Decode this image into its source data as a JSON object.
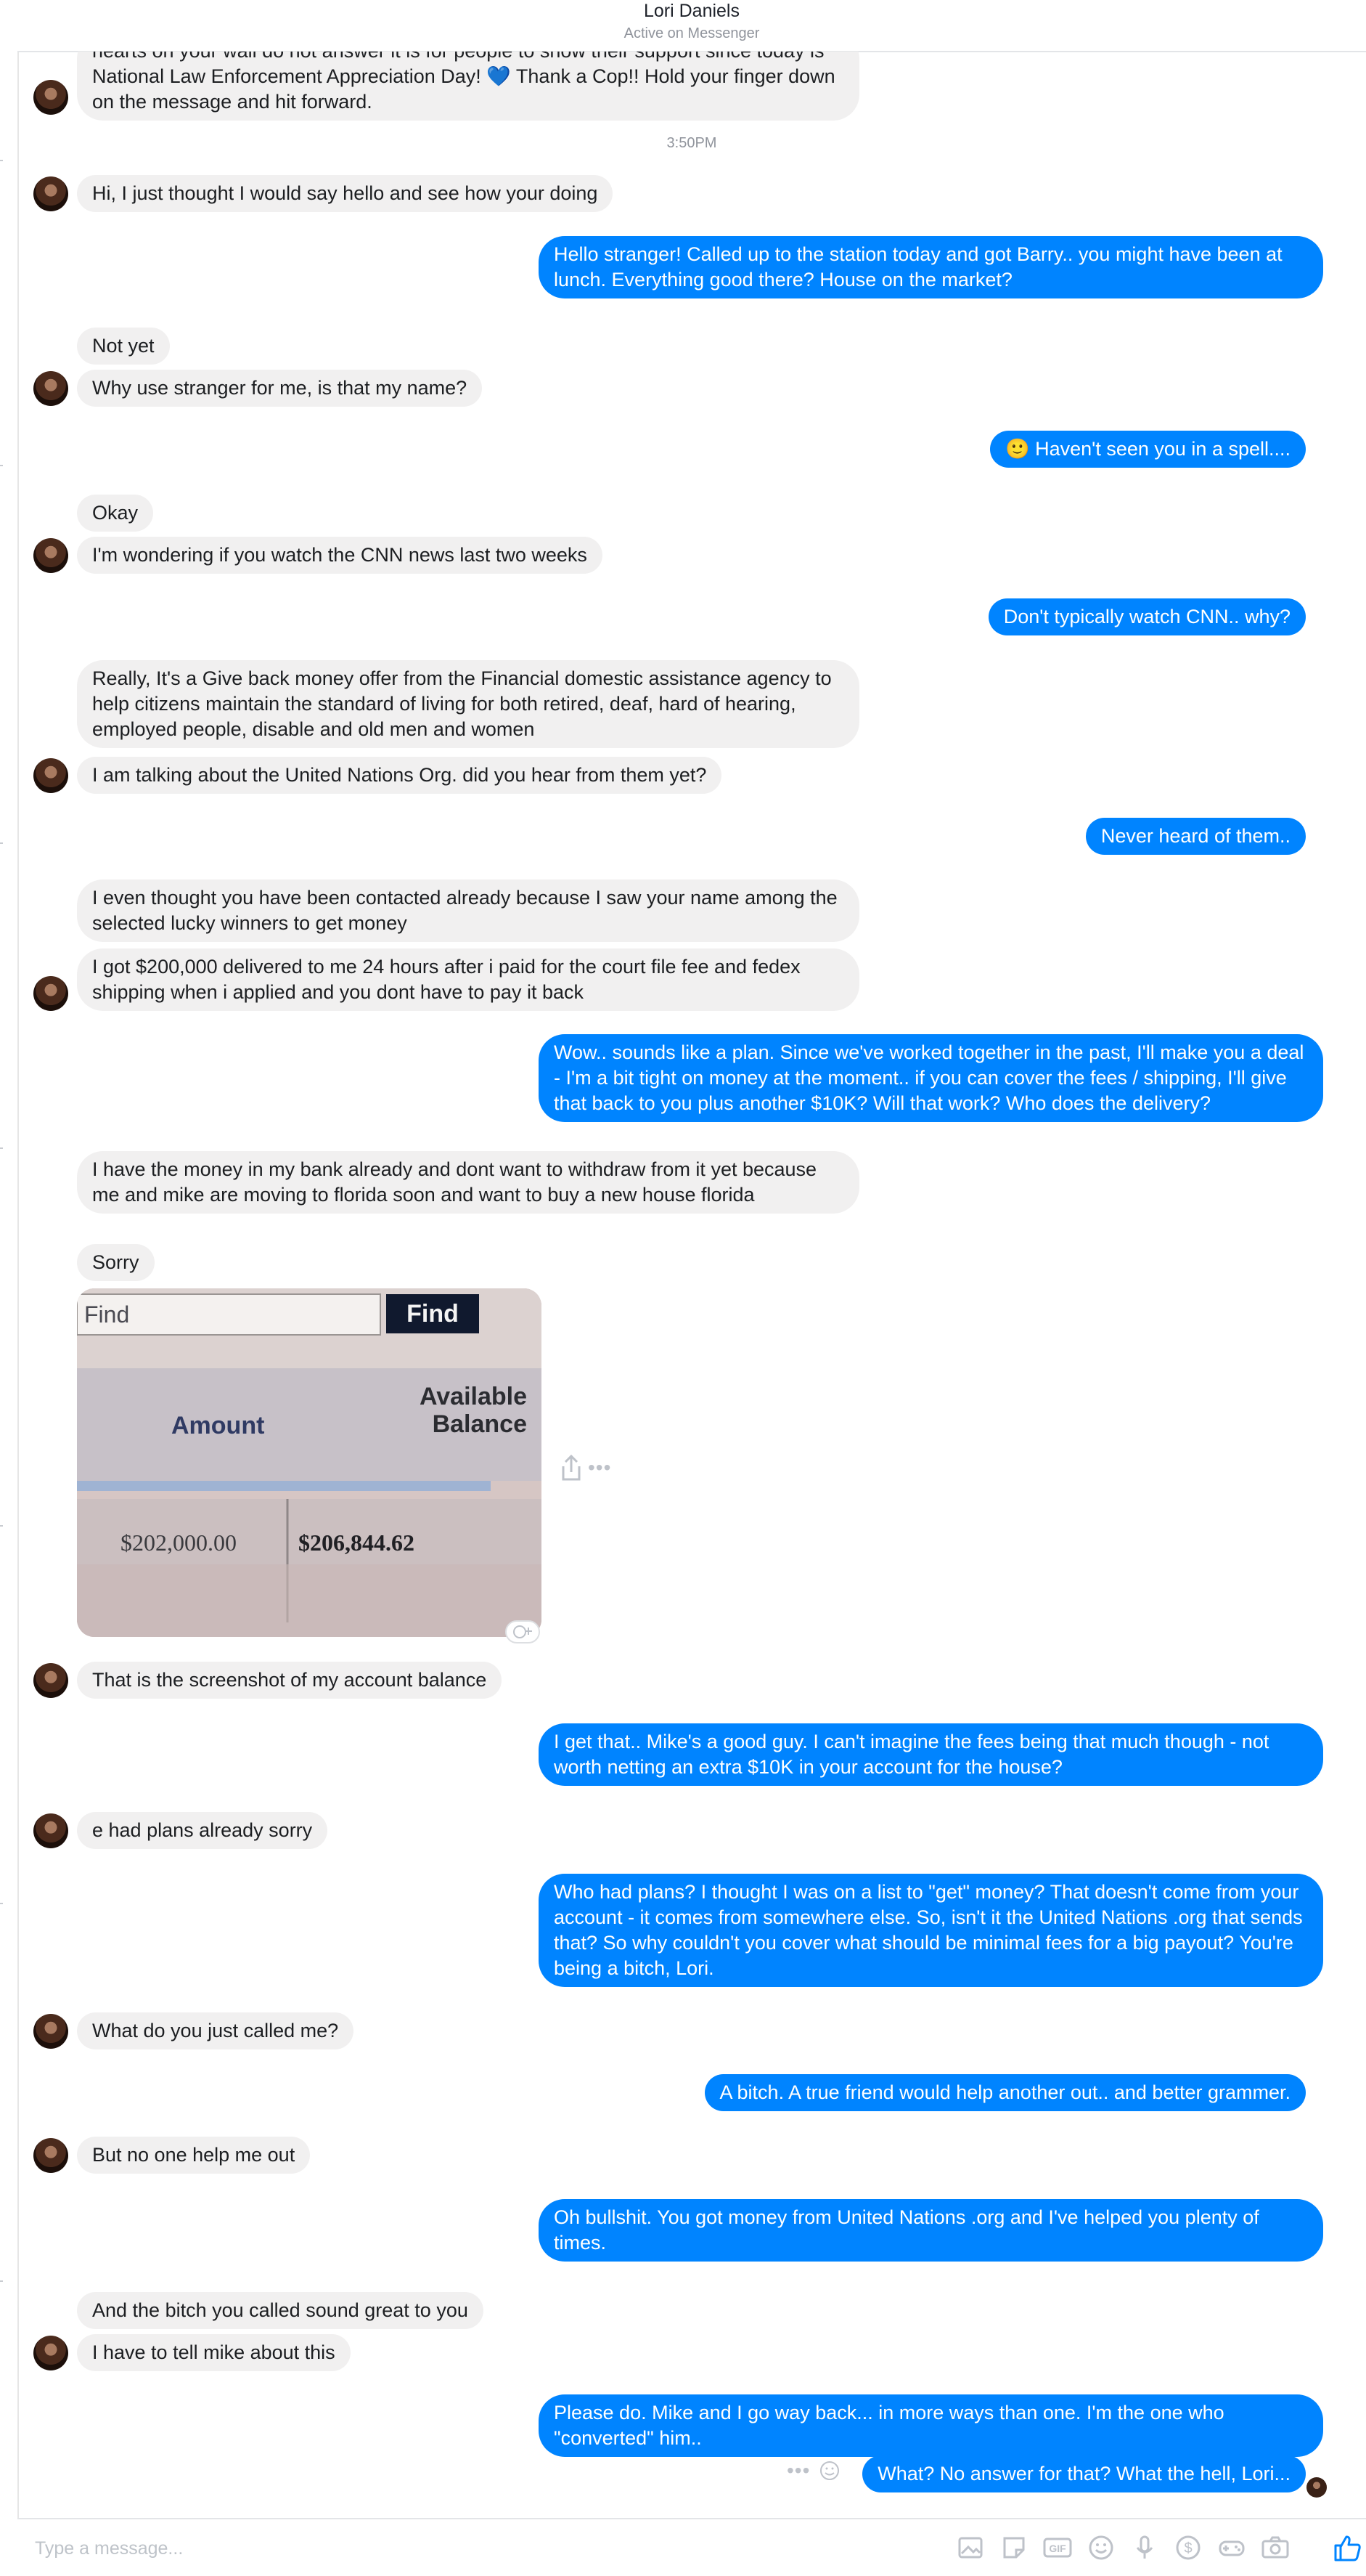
{
  "header": {
    "name": "Lori Daniels",
    "status": "Active on Messenger"
  },
  "colors": {
    "accent": "#0084ff",
    "incoming": "#f1f0f0"
  },
  "thread": {
    "partial_message": "hearts on your wall do not answer it is for people to show their support since today is National Law Enforcement Appreciation Day! 💙 Thank a Cop!! Hold your finger down on the message and hit forward.",
    "timestamp": "3:50PM",
    "messages": [
      {
        "from": "them",
        "text": "Hi, I just thought I would say hello and see how your doing"
      },
      {
        "from": "me",
        "text": "Hello stranger! Called up to the station today and got Barry.. you might have been at lunch. Everything good there? House on the market?"
      },
      {
        "from": "them",
        "text": "Not yet"
      },
      {
        "from": "them",
        "text": "Why use stranger for me, is that my name?"
      },
      {
        "from": "me",
        "text": "🙂 Haven't seen you in a spell...."
      },
      {
        "from": "them",
        "text": "Okay"
      },
      {
        "from": "them",
        "text": "I'm wondering if you watch the CNN news last two weeks"
      },
      {
        "from": "me",
        "text": "Don't typically watch CNN.. why?"
      },
      {
        "from": "them",
        "text": "Really, It's a Give back money offer from the Financial domestic assistance agency to help citizens maintain the standard of living for both retired, deaf, hard of hearing, employed people, disable and old men and women"
      },
      {
        "from": "them",
        "text": "I am talking about the United Nations Org. did you hear from them yet?"
      },
      {
        "from": "me",
        "text": "Never heard of them.."
      },
      {
        "from": "them",
        "text": "I even thought you have been contacted already because I saw your name among the selected lucky winners to get money"
      },
      {
        "from": "them",
        "text": "I got $200,000 delivered to me 24 hours after i paid for the court file fee and fedex shipping when i applied and you dont have to pay it back"
      },
      {
        "from": "me",
        "text": "Wow.. sounds like a plan. Since we've worked together in the past, I'll make you a deal - I'm a bit tight on money at the moment.. if you can cover the fees / shipping, I'll give that back to you plus another $10K? Will that work? Who does the delivery?"
      },
      {
        "from": "them",
        "text": "I have the money in my bank already and dont want to withdraw from it yet because me and mike are moving to florida soon and want to buy a new house florida"
      },
      {
        "from": "them",
        "text": "Sorry"
      },
      {
        "from": "them",
        "text": "That is the screenshot of my account balance"
      },
      {
        "from": "me",
        "text": "I get that.. Mike's a good guy. I can't imagine the fees being that much though - not worth netting an extra $10K in your account for the house?"
      },
      {
        "from": "them",
        "text": "e had plans already sorry"
      },
      {
        "from": "me",
        "text": "Who had plans? I thought I was on a list to \"get\" money? That doesn't come from your account - it comes from somewhere else. So, isn't it the United Nations .org that sends that? So why couldn't you cover what should be minimal fees for a big payout? You're being a bitch, Lori."
      },
      {
        "from": "them",
        "text": "What do you just called me?"
      },
      {
        "from": "me",
        "text": "A bitch. A true friend would help another out.. and better grammer."
      },
      {
        "from": "them",
        "text": "But no one help me out"
      },
      {
        "from": "me",
        "text": "Oh bullshit. You got money from United Nations .org and I've helped you plenty of times."
      },
      {
        "from": "them",
        "text": "And the bitch you called sound great to you"
      },
      {
        "from": "them",
        "text": "I have to tell mike about this"
      },
      {
        "from": "me",
        "text": "Please do. Mike and I go way back... in more ways than one. I'm the one who \"converted\" him.."
      },
      {
        "from": "me",
        "text": "What? No answer for that? What the hell, Lori..."
      }
    ],
    "image_attachment": {
      "find_placeholder": "Find",
      "find_button": "Find",
      "col_amount": "Amount",
      "col_available_1": "Available",
      "col_available_2": "Balance",
      "amount_value": "$202,000.00",
      "balance_value": "$206,844.62"
    }
  },
  "composer": {
    "placeholder": "Type a message..."
  },
  "toolbar_icons": [
    "photo-icon",
    "sticker-icon",
    "gif-icon",
    "emoji-icon",
    "microphone-icon",
    "payment-icon",
    "game-icon",
    "camera-icon",
    "thumbs-up-icon"
  ]
}
